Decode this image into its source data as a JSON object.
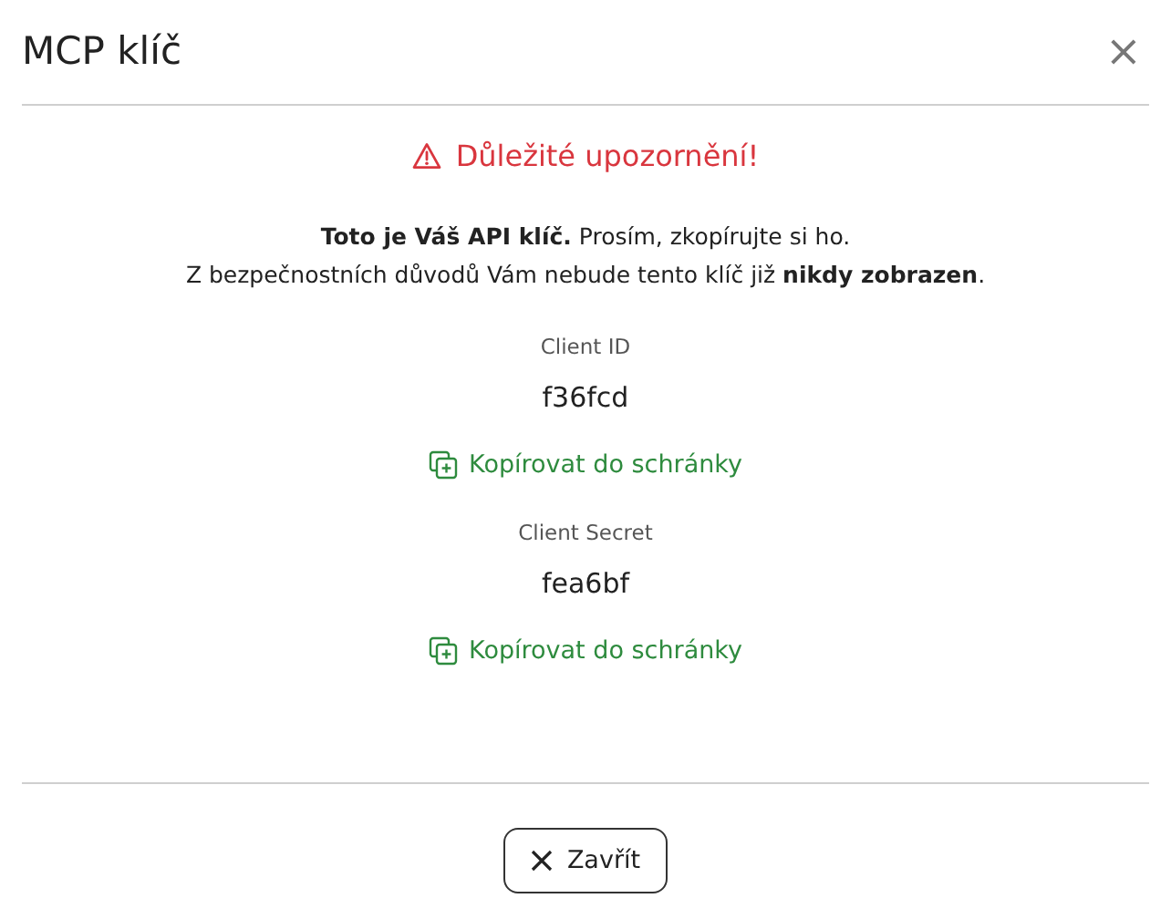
{
  "dialog": {
    "title": "MCP klíč",
    "close_icon": "×"
  },
  "warning": "Důležité upozornění!",
  "message": [
    "**Toto je Váš API klíč.** Prosím, zkopírujte si ho.",
    "Z bezpečnostních důvodů Vám nebude tento klíč již **nikdy zobrazen**."
  ],
  "fields": [
    {
      "label": "Client ID",
      "value": "f36fcd",
      "copy_button": "Kopírovat do schránky"
    },
    {
      "label": "Client Secret",
      "value": "fea6bf",
      "copy_button": "Kopírovat do schránky"
    }
  ],
  "footer_button": "Zavřít"
}
